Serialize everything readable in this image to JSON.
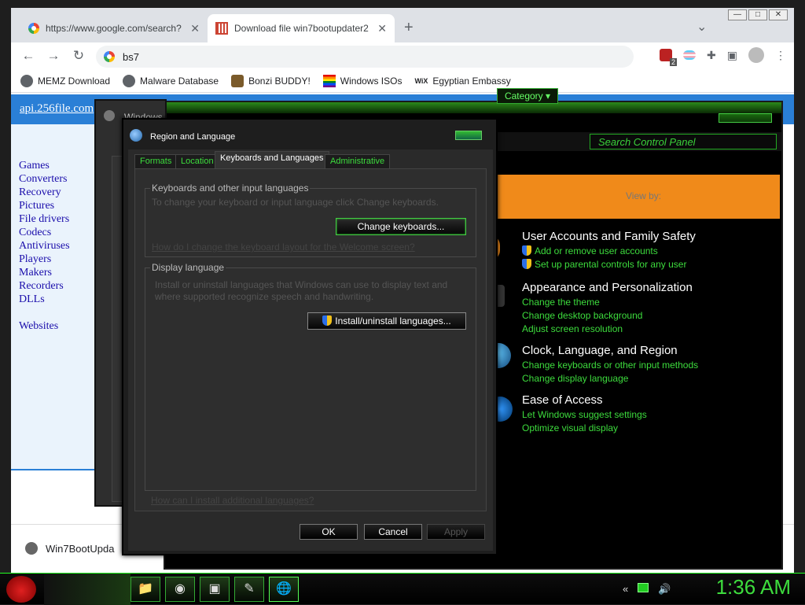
{
  "chrome": {
    "tabs": [
      {
        "title": "https://www.google.com/search?",
        "close": "✕"
      },
      {
        "title": "Download file win7bootupdater2",
        "close": "✕"
      }
    ],
    "new_tab": "+",
    "tab_list": "⌄",
    "window_controls": [
      "—",
      "□",
      "✕"
    ],
    "nav": {
      "back": "←",
      "forward": "→",
      "reload": "↻"
    },
    "omnibox_value": "bs7",
    "ext_badge": "2",
    "bookmarks": [
      "MEMZ Download",
      "Malware Database",
      "Bonzi BUDDY!",
      "Windows ISOs",
      "Egyptian Embassy"
    ],
    "bookmark_wix": "WiX"
  },
  "site": {
    "link": "api.256file.com",
    "nav": [
      "Games",
      "Converters",
      "Recovery",
      "Pictures",
      "File drivers",
      "Codecs",
      "Antiviruses",
      "Players",
      "Makers",
      "Recorders",
      "DLLs"
    ],
    "websites": "Websites",
    "download_item": "Win7BootUpda"
  },
  "windows_dialog": {
    "title": "Windows"
  },
  "control_panel": {
    "search_placeholder": "Search Control Panel",
    "view_by": "View by:",
    "category": "Category ▾",
    "sections": [
      {
        "title": "User Accounts and Family Safety",
        "links": [
          "Add or remove user accounts",
          "Set up parental controls for any user"
        ]
      },
      {
        "title": "Appearance and Personalization",
        "links": [
          "Change the theme",
          "Change desktop background",
          "Adjust screen resolution"
        ]
      },
      {
        "title": "Clock, Language, and Region",
        "links": [
          "Change keyboards or other input methods",
          "Change display language"
        ]
      },
      {
        "title": "Ease of Access",
        "links": [
          "Let Windows suggest settings",
          "Optimize visual display"
        ]
      }
    ]
  },
  "region_dialog": {
    "title": "Region and Language",
    "tabs": [
      "Formats",
      "Location",
      "Keyboards and Languages",
      "Administrative"
    ],
    "group1": {
      "legend": "Keyboards and other input languages",
      "desc": "To change your keyboard or input language click Change keyboards.",
      "button": "Change keyboards...",
      "link": "How do I change the keyboard layout for the Welcome screen?"
    },
    "group2": {
      "legend": "Display language",
      "desc_line1": "Install or uninstall languages that Windows can use to display text and",
      "desc_line2": "where supported recognize speech and handwriting.",
      "button": "Install/uninstall languages..."
    },
    "bottom_link": "How can I install additional languages?",
    "buttons": {
      "ok": "OK",
      "cancel": "Cancel",
      "apply": "Apply"
    }
  },
  "taskbar": {
    "clock": "1:36 AM"
  }
}
